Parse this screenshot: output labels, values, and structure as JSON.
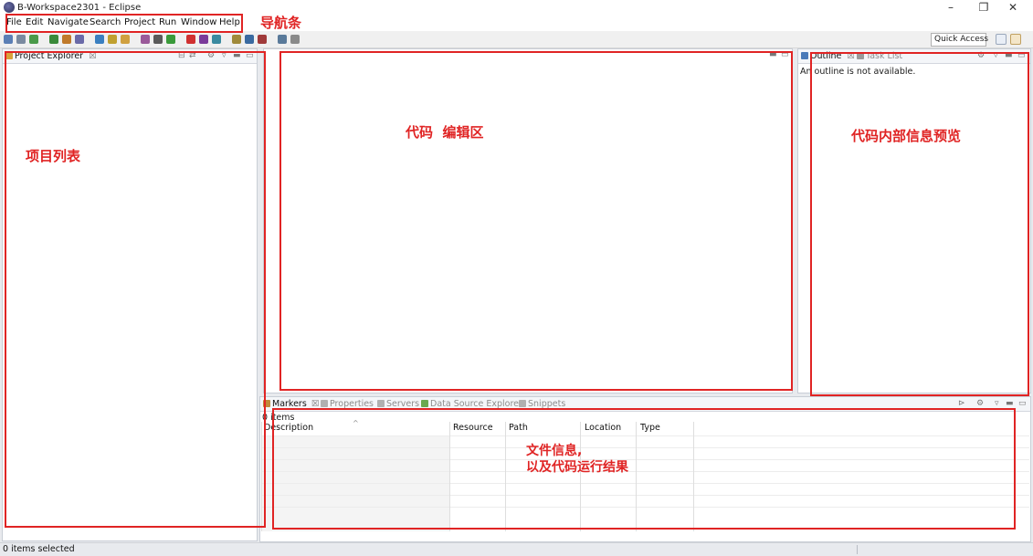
{
  "window": {
    "title": "B-Workspace2301 - Eclipse",
    "minimize": "–",
    "maximize": "❐",
    "close": "✕"
  },
  "menu": [
    "File",
    "Edit",
    "Navigate",
    "Search",
    "Project",
    "Run",
    "Window",
    "Help"
  ],
  "toolbar": {
    "quick_access": "Quick Access",
    "icon_colors": [
      "#5b7fb5",
      "#7a8aa0",
      "#4a9a4a",
      "#3a8a3a",
      "#c07a2a",
      "#6a6aa8",
      "#3a7fc0",
      "#c0a030",
      "#d0a040",
      "#9a5a9a",
      "#5a5a5a",
      "#3a9a3a",
      "#d03030",
      "#7a3a9a",
      "#3a8aa0",
      "#a08a3a",
      "#3a6aa0",
      "#a03a3a",
      "#5a7a9a",
      "#8a8a8a"
    ]
  },
  "project_explorer": {
    "tab": "Project Explorer",
    "close_glyph": "☒"
  },
  "editor": {},
  "outline": {
    "tab": "Outline",
    "tab2": "Task List",
    "message": "An outline is not available."
  },
  "markers": {
    "tabs": [
      "Markers",
      "Properties",
      "Servers",
      "Data Source Explorer",
      "Snippets"
    ],
    "count": "0 items",
    "columns": [
      "Description",
      "Resource",
      "Path",
      "Location",
      "Type"
    ],
    "sort_indicator": "^"
  },
  "status": {
    "text": "0 items selected"
  },
  "annotations": {
    "navbar": "导航条",
    "project_list": "项目列表",
    "editor_area": "代码  编辑区",
    "outline_area": "代码内部信息预览",
    "bottom_line1": "文件信息,",
    "bottom_line2": "以及代码运行结果"
  },
  "colors": {
    "annotation_red": "#e02424",
    "panel_border": "#c9ced6",
    "workbench_bg": "#e8eaee"
  }
}
